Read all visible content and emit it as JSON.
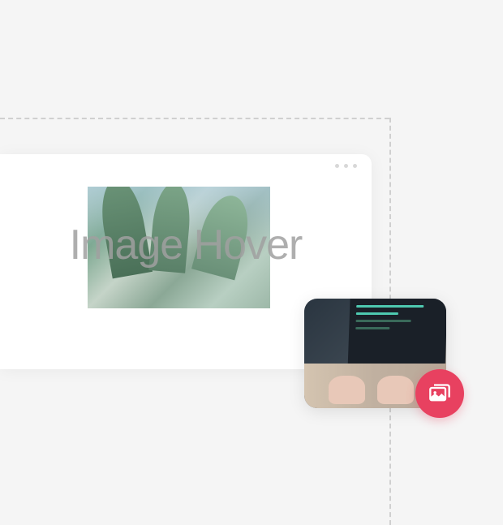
{
  "feature": {
    "title": "Image Hover"
  },
  "badge": {
    "icon_name": "images-icon"
  },
  "colors": {
    "background": "#f5f5f5",
    "accent": "#e84160",
    "text_muted": "#a0a0a0"
  }
}
